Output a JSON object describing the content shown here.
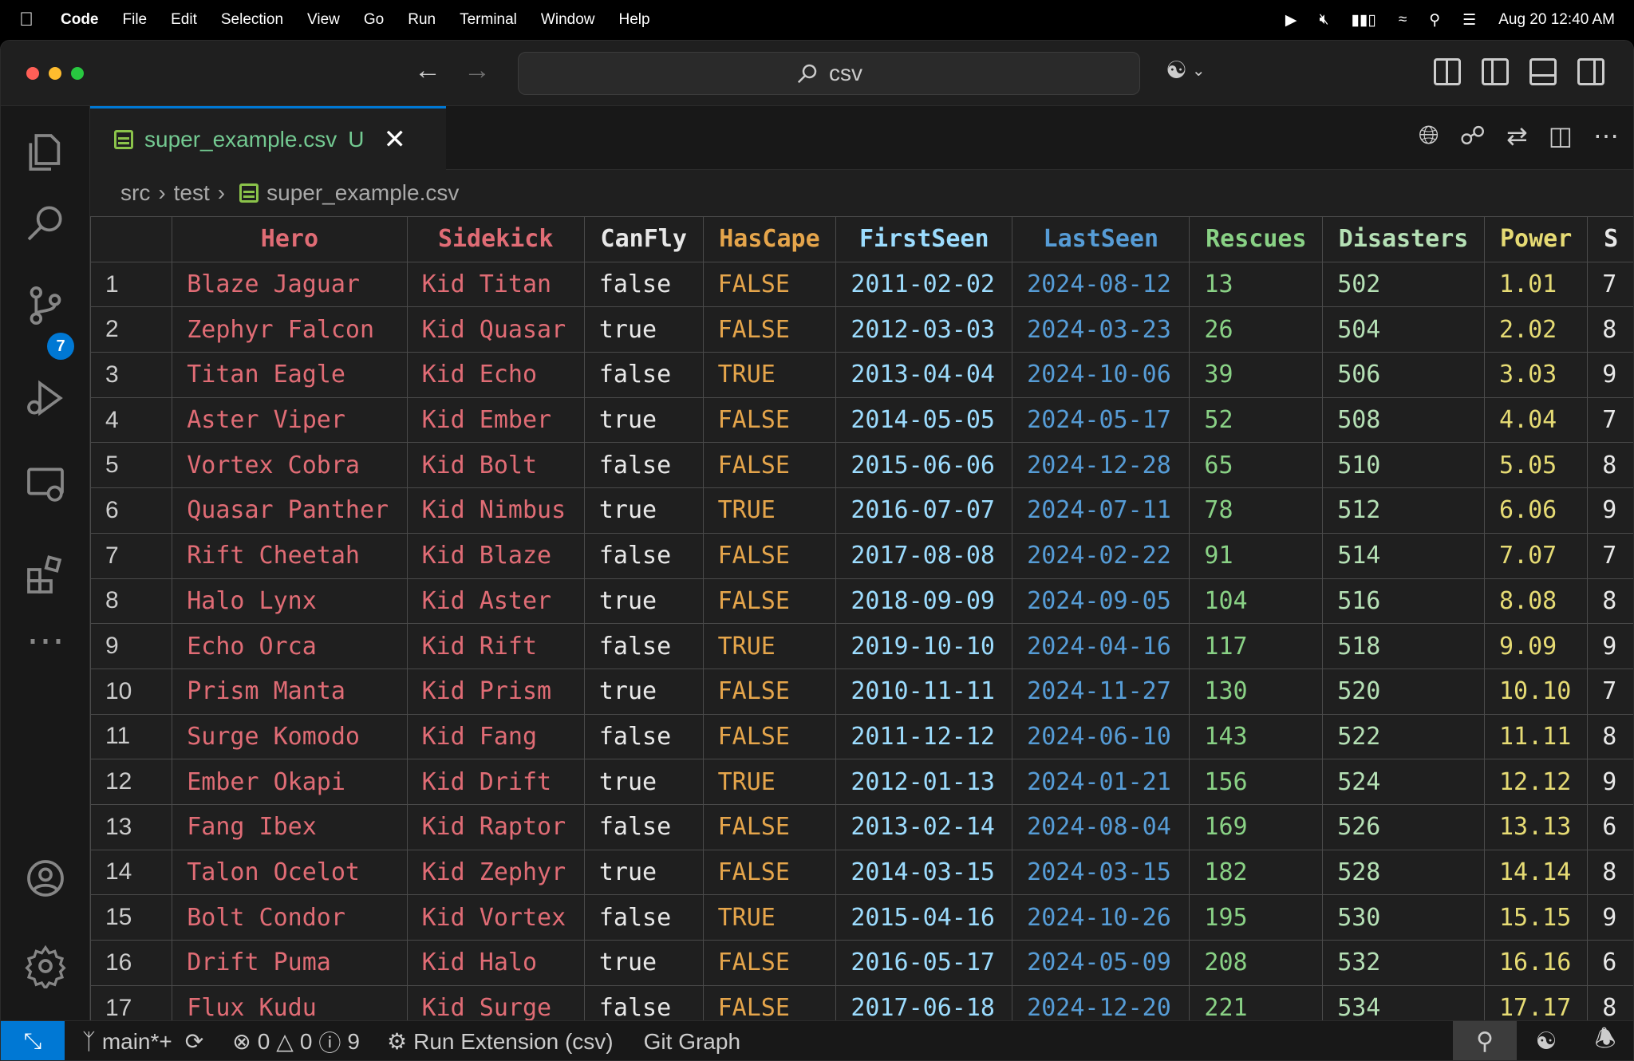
{
  "menubar": {
    "app": "Code",
    "items": [
      "File",
      "Edit",
      "Selection",
      "View",
      "Go",
      "Run",
      "Terminal",
      "Window",
      "Help"
    ],
    "datetime": "Aug 20  12:40 AM"
  },
  "titlebar": {
    "search_text": "csv"
  },
  "activity": {
    "scm_badge": "7"
  },
  "tab": {
    "filename": "super_example.csv",
    "status": "U"
  },
  "breadcrumb": {
    "folder1": "src",
    "folder2": "test",
    "file": "super_example.csv"
  },
  "colors": {
    "hero": "#e06c75",
    "sidekick": "#e06c75",
    "canfly": "#e8e8e8",
    "hascape": "#e5a54b",
    "firstseen": "#9cdcfe",
    "lastseen": "#569cd6",
    "rescues": "#89d185",
    "disasters": "#b5e0b5",
    "power": "#e6db74",
    "s": "#e8e8e8"
  },
  "table": {
    "headers": [
      "",
      "Hero",
      "Sidekick",
      "CanFly",
      "HasCape",
      "FirstSeen",
      "LastSeen",
      "Rescues",
      "Disasters",
      "Power",
      "S"
    ],
    "rows": [
      [
        "1",
        "Blaze Jaguar",
        "Kid Titan",
        "false",
        "FALSE",
        "2011-02-02",
        "2024-08-12",
        "13",
        "502",
        "1.01",
        "7"
      ],
      [
        "2",
        "Zephyr Falcon",
        "Kid Quasar",
        "true",
        "FALSE",
        "2012-03-03",
        "2024-03-23",
        "26",
        "504",
        "2.02",
        "8"
      ],
      [
        "3",
        "Titan Eagle",
        "Kid Echo",
        "false",
        "TRUE",
        "2013-04-04",
        "2024-10-06",
        "39",
        "506",
        "3.03",
        "9"
      ],
      [
        "4",
        "Aster Viper",
        "Kid Ember",
        "true",
        "FALSE",
        "2014-05-05",
        "2024-05-17",
        "52",
        "508",
        "4.04",
        "7"
      ],
      [
        "5",
        "Vortex Cobra",
        "Kid Bolt",
        "false",
        "FALSE",
        "2015-06-06",
        "2024-12-28",
        "65",
        "510",
        "5.05",
        "8"
      ],
      [
        "6",
        "Quasar Panther",
        "Kid Nimbus",
        "true",
        "TRUE",
        "2016-07-07",
        "2024-07-11",
        "78",
        "512",
        "6.06",
        "9"
      ],
      [
        "7",
        "Rift Cheetah",
        "Kid Blaze",
        "false",
        "FALSE",
        "2017-08-08",
        "2024-02-22",
        "91",
        "514",
        "7.07",
        "7"
      ],
      [
        "8",
        "Halo Lynx",
        "Kid Aster",
        "true",
        "FALSE",
        "2018-09-09",
        "2024-09-05",
        "104",
        "516",
        "8.08",
        "8"
      ],
      [
        "9",
        "Echo Orca",
        "Kid Rift",
        "false",
        "TRUE",
        "2019-10-10",
        "2024-04-16",
        "117",
        "518",
        "9.09",
        "9"
      ],
      [
        "10",
        "Prism Manta",
        "Kid Prism",
        "true",
        "FALSE",
        "2010-11-11",
        "2024-11-27",
        "130",
        "520",
        "10.10",
        "7"
      ],
      [
        "11",
        "Surge Komodo",
        "Kid Fang",
        "false",
        "FALSE",
        "2011-12-12",
        "2024-06-10",
        "143",
        "522",
        "11.11",
        "8"
      ],
      [
        "12",
        "Ember Okapi",
        "Kid Drift",
        "true",
        "TRUE",
        "2012-01-13",
        "2024-01-21",
        "156",
        "524",
        "12.12",
        "9"
      ],
      [
        "13",
        "Fang Ibex",
        "Kid Raptor",
        "false",
        "FALSE",
        "2013-02-14",
        "2024-08-04",
        "169",
        "526",
        "13.13",
        "6"
      ],
      [
        "14",
        "Talon Ocelot",
        "Kid Zephyr",
        "true",
        "FALSE",
        "2014-03-15",
        "2024-03-15",
        "182",
        "528",
        "14.14",
        "8"
      ],
      [
        "15",
        "Bolt Condor",
        "Kid Vortex",
        "false",
        "TRUE",
        "2015-04-16",
        "2024-10-26",
        "195",
        "530",
        "15.15",
        "9"
      ],
      [
        "16",
        "Drift Puma",
        "Kid Halo",
        "true",
        "FALSE",
        "2016-05-17",
        "2024-05-09",
        "208",
        "532",
        "16.16",
        "6"
      ],
      [
        "17",
        "Flux Kudu",
        "Kid Surge",
        "false",
        "FALSE",
        "2017-06-18",
        "2024-12-20",
        "221",
        "534",
        "17.17",
        "8"
      ]
    ]
  },
  "statusbar": {
    "branch": "main*+",
    "errors": "0",
    "warnings": "0",
    "info": "9",
    "run": "Run Extension (csv)",
    "git_graph": "Git Graph"
  }
}
